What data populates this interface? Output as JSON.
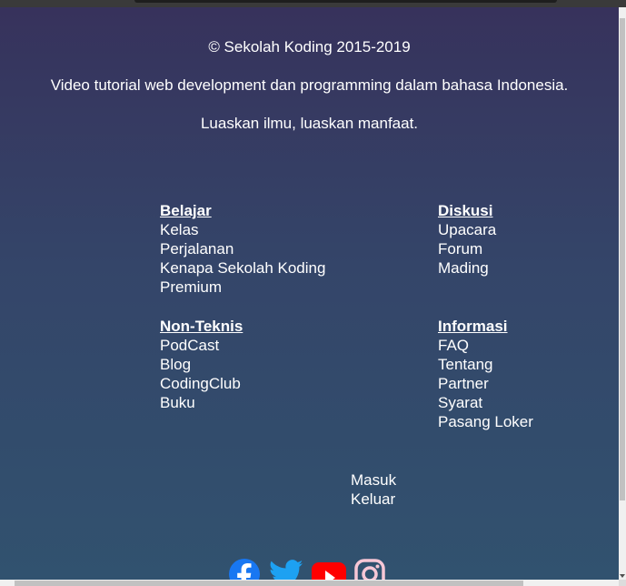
{
  "footer": {
    "copyright": "© Sekolah Koding 2015-2019",
    "tagline": "Video tutorial web development dan programming dalam bahasa Indonesia.",
    "motto": "Luaskan ilmu, luaskan manfaat."
  },
  "nav": {
    "belajar": {
      "title": "Belajar",
      "links": [
        "Kelas",
        "Perjalanan",
        "Kenapa Sekolah Koding",
        "Premium"
      ]
    },
    "diskusi": {
      "title": "Diskusi",
      "links": [
        "Upacara",
        "Forum",
        "Mading"
      ]
    },
    "nonteknis": {
      "title": "Non-Teknis",
      "links": [
        "PodCast",
        "Blog",
        "CodingClub",
        "Buku"
      ]
    },
    "informasi": {
      "title": "Informasi",
      "links": [
        "FAQ",
        "Tentang",
        "Partner",
        "Syarat",
        "Pasang Loker"
      ]
    }
  },
  "auth": {
    "login": "Masuk",
    "logout": "Keluar"
  },
  "social": [
    {
      "icon": "facebook-icon",
      "color": "#1877f2"
    },
    {
      "icon": "twitter-icon",
      "color": "#1da1f2"
    },
    {
      "icon": "youtube-icon",
      "color": "#ff0000"
    },
    {
      "icon": "instagram-icon",
      "color": "#f7c7d6"
    }
  ]
}
